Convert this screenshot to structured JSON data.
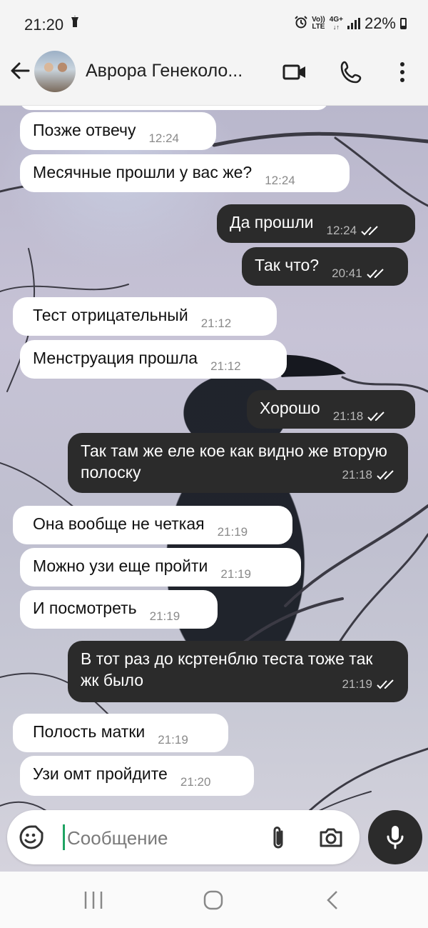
{
  "status_bar": {
    "time": "21:20",
    "volte": "Vo))",
    "lte": "LTE",
    "network": "4G+",
    "battery": "22%"
  },
  "header": {
    "contact_name": "Аврора Генеколо...",
    "icons": [
      "back-arrow-icon",
      "video-call-icon",
      "phone-icon",
      "more-vert-icon"
    ]
  },
  "messages": [
    {
      "dir": "in",
      "text": "Позже отвечу",
      "time": "12:24"
    },
    {
      "dir": "in",
      "text": "Месячные прошли у вас же?",
      "time": "12:24"
    },
    {
      "dir": "out",
      "text": "Да прошли",
      "time": "12:24"
    },
    {
      "dir": "out",
      "text": "Так что?",
      "time": "20:41"
    },
    {
      "dir": "in",
      "text": "Тест отрицательный",
      "time": "21:12"
    },
    {
      "dir": "in",
      "text": "Менструация прошла",
      "time": "21:12"
    },
    {
      "dir": "out",
      "text": "Хорошо",
      "time": "21:18"
    },
    {
      "dir": "out",
      "text": "Так там же еле кое как видно же вторую полоску",
      "time": "21:18"
    },
    {
      "dir": "in",
      "text": "Она вообще не четкая",
      "time": "21:19"
    },
    {
      "dir": "in",
      "text": "Можно узи еще пройти",
      "time": "21:19"
    },
    {
      "dir": "in",
      "text": "И посмотреть",
      "time": "21:19"
    },
    {
      "dir": "out",
      "text": "В тот раз до кcртенблю теста тоже так жк было",
      "time": "21:19"
    },
    {
      "dir": "in",
      "text": "Полость матки",
      "time": "21:19"
    },
    {
      "dir": "in",
      "text": "Узи омт пройдите",
      "time": "21:20"
    }
  ],
  "input": {
    "placeholder": "Сообщение"
  },
  "colors": {
    "outgoing_bubble": "#2b2b2b",
    "incoming_bubble": "#ffffff",
    "read_ticks": "#ffffff",
    "cursor": "#1fa463"
  }
}
